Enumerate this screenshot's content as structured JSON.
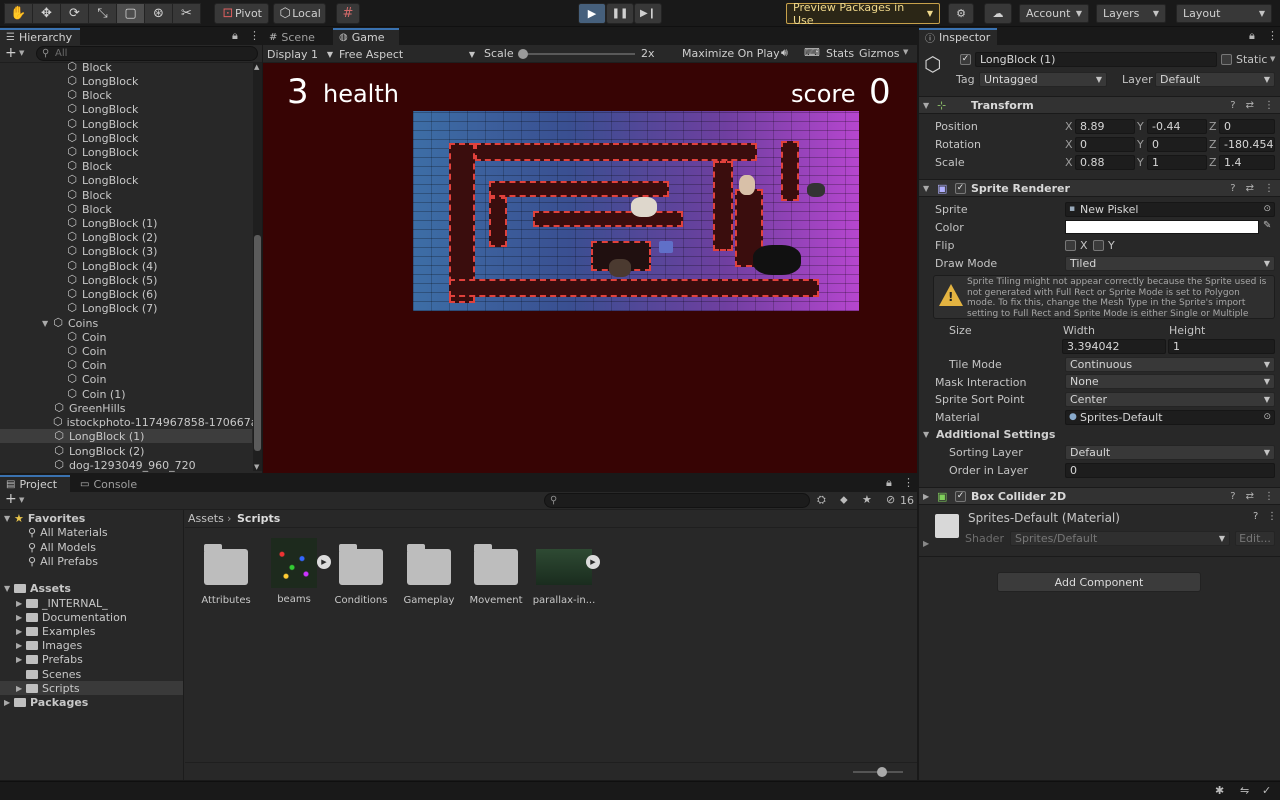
{
  "toolbar": {
    "pivot_label": "Pivot",
    "local_label": "Local",
    "preview_packages_label": "Preview Packages in Use",
    "account_label": "Account",
    "layers_label": "Layers",
    "layout_label": "Layout"
  },
  "hierarchy": {
    "tab_label": "Hierarchy",
    "search_placeholder": "All",
    "rows": [
      {
        "label": "Block"
      },
      {
        "label": "LongBlock"
      },
      {
        "label": "Block"
      },
      {
        "label": "LongBlock"
      },
      {
        "label": "LongBlock"
      },
      {
        "label": "LongBlock"
      },
      {
        "label": "LongBlock"
      },
      {
        "label": "Block"
      },
      {
        "label": "LongBlock"
      },
      {
        "label": "Block"
      },
      {
        "label": "Block"
      },
      {
        "label": "LongBlock (1)"
      },
      {
        "label": "LongBlock (2)"
      },
      {
        "label": "LongBlock (3)"
      },
      {
        "label": "LongBlock (4)"
      },
      {
        "label": "LongBlock (5)"
      },
      {
        "label": "LongBlock (6)"
      },
      {
        "label": "LongBlock (7)"
      },
      {
        "label": "Coins"
      },
      {
        "label": "Coin"
      },
      {
        "label": "Coin"
      },
      {
        "label": "Coin"
      },
      {
        "label": "Coin"
      },
      {
        "label": "Coin (1)"
      },
      {
        "label": "GreenHills"
      },
      {
        "label": "istockphoto-1174967858-170667a"
      },
      {
        "label": "LongBlock (1)"
      },
      {
        "label": "LongBlock (2)"
      },
      {
        "label": "dog-1293049_960_720"
      }
    ]
  },
  "scene_tabs": {
    "scene_label": "Scene",
    "game_label": "Game"
  },
  "game_bar": {
    "display": "Display 1",
    "aspect": "Free Aspect",
    "scale_label": "Scale",
    "scale_value": "2x",
    "maximize_label": "Maximize On Play",
    "stats_label": "Stats",
    "gizmos_label": "Gizmos"
  },
  "game_hud": {
    "health_value": "3",
    "health_label": "health",
    "score_label": "score",
    "score_value": "0"
  },
  "inspector": {
    "tab_label": "Inspector",
    "object_name": "LongBlock (1)",
    "static_label": "Static",
    "tag_label": "Tag",
    "tag_value": "Untagged",
    "layer_label": "Layer",
    "layer_value": "Default",
    "transform": {
      "title": "Transform",
      "position_label": "Position",
      "pos_x": "8.89",
      "pos_y": "-0.44",
      "pos_z": "0",
      "rotation_label": "Rotation",
      "rot_x": "0",
      "rot_y": "0",
      "rot_z": "-180.454",
      "scale_label": "Scale",
      "scale_x": "0.88",
      "scale_y": "1",
      "scale_z": "1.4"
    },
    "sprite_renderer": {
      "title": "Sprite Renderer",
      "sprite_label": "Sprite",
      "sprite_value": "New Piskel",
      "color_label": "Color",
      "color_value": "#ffffff",
      "flip_label": "Flip",
      "flip_x": "X",
      "flip_y": "Y",
      "draw_mode_label": "Draw Mode",
      "draw_mode_value": "Tiled",
      "warning": "Sprite Tiling might not appear correctly because the Sprite used is not generated with Full Rect or Sprite Mode is set to Polygon mode. To fix this, change the Mesh Type in the Sprite's import setting to Full Rect and Sprite Mode is either Single or Multiple",
      "size_label": "Size",
      "width_label": "Width",
      "height_label": "Height",
      "width_value": "3.394042",
      "height_value": "1",
      "tile_mode_label": "Tile Mode",
      "tile_mode_value": "Continuous",
      "mask_label": "Mask Interaction",
      "mask_value": "None",
      "sort_point_label": "Sprite Sort Point",
      "sort_point_value": "Center",
      "material_label": "Material",
      "material_value": "Sprites-Default",
      "additional_label": "Additional Settings",
      "sorting_layer_label": "Sorting Layer",
      "sorting_layer_value": "Default",
      "order_label": "Order in Layer",
      "order_value": "0"
    },
    "box_collider": {
      "title": "Box Collider 2D"
    },
    "material_block": {
      "name": "Sprites-Default (Material)",
      "shader_label": "Shader",
      "shader_value": "Sprites/Default",
      "edit_label": "Edit..."
    },
    "add_component_label": "Add Component"
  },
  "project": {
    "project_tab": "Project",
    "console_tab": "Console",
    "hidden_count": "16",
    "favorites_label": "Favorites",
    "favorites": [
      {
        "label": "All Materials"
      },
      {
        "label": "All Models"
      },
      {
        "label": "All Prefabs"
      }
    ],
    "assets_label": "Assets",
    "asset_folders": [
      {
        "label": "_INTERNAL_"
      },
      {
        "label": "Documentation"
      },
      {
        "label": "Examples"
      },
      {
        "label": "Images"
      },
      {
        "label": "Prefabs"
      },
      {
        "label": "Scenes"
      },
      {
        "label": "Scripts"
      }
    ],
    "packages_label": "Packages",
    "breadcrumb_root": "Assets",
    "breadcrumb_current": "Scripts",
    "items": [
      {
        "label": "Attributes"
      },
      {
        "label": "beams"
      },
      {
        "label": "Conditions"
      },
      {
        "label": "Gameplay"
      },
      {
        "label": "Movement"
      },
      {
        "label": "parallax-in..."
      }
    ]
  },
  "colors": {
    "accent": "#3a72b0",
    "game_background": "#370404",
    "preview_border": "#c7a14b"
  }
}
